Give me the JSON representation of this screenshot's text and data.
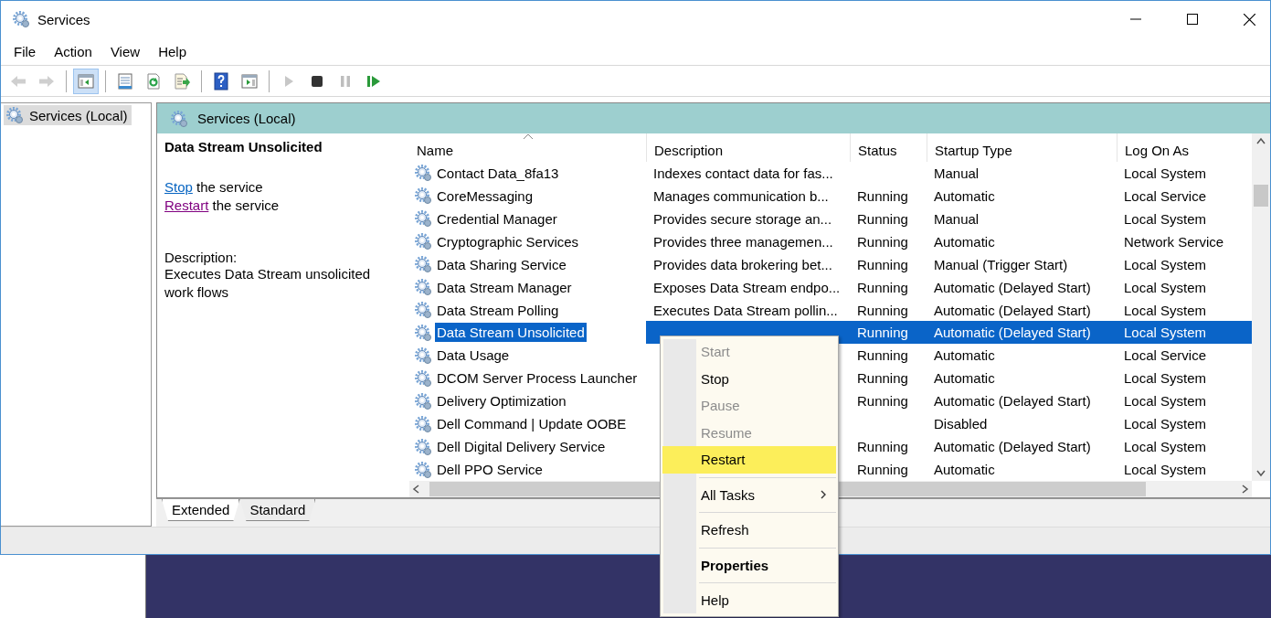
{
  "window": {
    "title": "Services"
  },
  "menu": [
    "File",
    "Action",
    "View",
    "Help"
  ],
  "toolbar": [
    {
      "kind": "back",
      "disabled": true,
      "pressed": false
    },
    {
      "kind": "forward",
      "disabled": true,
      "pressed": false
    },
    {
      "kind": "separator"
    },
    {
      "kind": "console-tree",
      "disabled": false,
      "pressed": true
    },
    {
      "kind": "separator"
    },
    {
      "kind": "properties",
      "disabled": false,
      "pressed": false
    },
    {
      "kind": "refresh",
      "disabled": false,
      "pressed": false
    },
    {
      "kind": "export",
      "disabled": false,
      "pressed": false
    },
    {
      "kind": "separator"
    },
    {
      "kind": "help",
      "disabled": false,
      "pressed": false
    },
    {
      "kind": "action-pane",
      "disabled": false,
      "pressed": false
    },
    {
      "kind": "separator"
    },
    {
      "kind": "start",
      "disabled": true,
      "pressed": false
    },
    {
      "kind": "stop",
      "disabled": false,
      "pressed": false
    },
    {
      "kind": "pause",
      "disabled": true,
      "pressed": false
    },
    {
      "kind": "restart",
      "disabled": false,
      "pressed": false
    }
  ],
  "tree": [
    {
      "label": "Services (Local)",
      "selected": true
    }
  ],
  "panel_title": "Services (Local)",
  "details": {
    "title": "Data Stream Unsolicited",
    "actions": [
      {
        "link": "Stop",
        "rest": " the service",
        "visited": false
      },
      {
        "link": "Restart",
        "rest": " the service",
        "visited": true
      }
    ],
    "description_label": "Description:",
    "description": "Executes Data Stream unsolicited work flows"
  },
  "columns": [
    {
      "label": "Name",
      "sorted": true
    },
    {
      "label": "Description",
      "sorted": false
    },
    {
      "label": "Status",
      "sorted": false
    },
    {
      "label": "Startup Type",
      "sorted": false
    },
    {
      "label": "Log On As",
      "sorted": false
    }
  ],
  "rows": [
    {
      "name": "Contact Data_8fa13",
      "description": "Indexes contact data for fas...",
      "startup_type": "Manual",
      "log_on_as": "Local System",
      "selected": false
    },
    {
      "name": "CoreMessaging",
      "description": "Manages communication b...",
      "status": "Running",
      "startup_type": "Automatic",
      "log_on_as": "Local Service",
      "selected": false
    },
    {
      "name": "Credential Manager",
      "description": "Provides secure storage an...",
      "status": "Running",
      "startup_type": "Manual",
      "log_on_as": "Local System",
      "selected": false
    },
    {
      "name": "Cryptographic Services",
      "description": "Provides three managemen...",
      "status": "Running",
      "startup_type": "Automatic",
      "log_on_as": "Network Service",
      "selected": false
    },
    {
      "name": "Data Sharing Service",
      "description": "Provides data brokering bet...",
      "status": "Running",
      "startup_type": "Manual (Trigger Start)",
      "log_on_as": "Local System",
      "selected": false
    },
    {
      "name": "Data Stream Manager",
      "description": "Exposes Data Stream endpo...",
      "status": "Running",
      "startup_type": "Automatic (Delayed Start)",
      "log_on_as": "Local System",
      "selected": false
    },
    {
      "name": "Data Stream Polling",
      "description": "Executes Data Stream pollin...",
      "status": "Running",
      "startup_type": "Automatic (Delayed Start)",
      "log_on_as": "Local System",
      "selected": false
    },
    {
      "name": "Data Stream Unsolicited",
      "status": "Running",
      "startup_type": "Automatic (Delayed Start)",
      "log_on_as": "Local System",
      "selected": true
    },
    {
      "name": "Data Usage",
      "status": "Running",
      "startup_type": "Automatic",
      "log_on_as": "Local Service",
      "selected": false
    },
    {
      "name": "DCOM Server Process Launcher",
      "status": "Running",
      "startup_type": "Automatic",
      "log_on_as": "Local System",
      "selected": false
    },
    {
      "name": "Delivery Optimization",
      "status": "Running",
      "startup_type": "Automatic (Delayed Start)",
      "log_on_as": "Local System",
      "selected": false
    },
    {
      "name": "Dell Command | Update OOBE",
      "startup_type": "Disabled",
      "log_on_as": "Local System",
      "selected": false
    },
    {
      "name": "Dell Digital Delivery Service",
      "status": "Running",
      "startup_type": "Automatic (Delayed Start)",
      "log_on_as": "Local System",
      "selected": false
    },
    {
      "name": "Dell PPO Service",
      "status": "Running",
      "startup_type": "Automatic",
      "log_on_as": "Local System",
      "selected": false
    }
  ],
  "context_menu": [
    {
      "kind": "item",
      "label": "Start",
      "disabled": true,
      "highlighted": false,
      "bold": false,
      "submenu": false
    },
    {
      "kind": "item",
      "label": "Stop",
      "disabled": false,
      "highlighted": false,
      "bold": false,
      "submenu": false
    },
    {
      "kind": "item",
      "label": "Pause",
      "disabled": true,
      "highlighted": false,
      "bold": false,
      "submenu": false
    },
    {
      "kind": "item",
      "label": "Resume",
      "disabled": true,
      "highlighted": false,
      "bold": false,
      "submenu": false
    },
    {
      "kind": "item",
      "label": "Restart",
      "disabled": false,
      "highlighted": true,
      "bold": false,
      "submenu": false
    },
    {
      "kind": "separator"
    },
    {
      "kind": "item",
      "label": "All Tasks",
      "disabled": false,
      "highlighted": false,
      "bold": false,
      "submenu": true
    },
    {
      "kind": "separator"
    },
    {
      "kind": "item",
      "label": "Refresh",
      "disabled": false,
      "highlighted": false,
      "bold": false,
      "submenu": false
    },
    {
      "kind": "separator"
    },
    {
      "kind": "item",
      "label": "Properties",
      "disabled": false,
      "highlighted": false,
      "bold": true,
      "submenu": false
    },
    {
      "kind": "separator"
    },
    {
      "kind": "item",
      "label": "Help",
      "disabled": false,
      "highlighted": false,
      "bold": false,
      "submenu": false
    }
  ],
  "view_tabs": [
    {
      "label": "Extended",
      "selected": true
    },
    {
      "label": "Standard",
      "selected": false
    }
  ]
}
